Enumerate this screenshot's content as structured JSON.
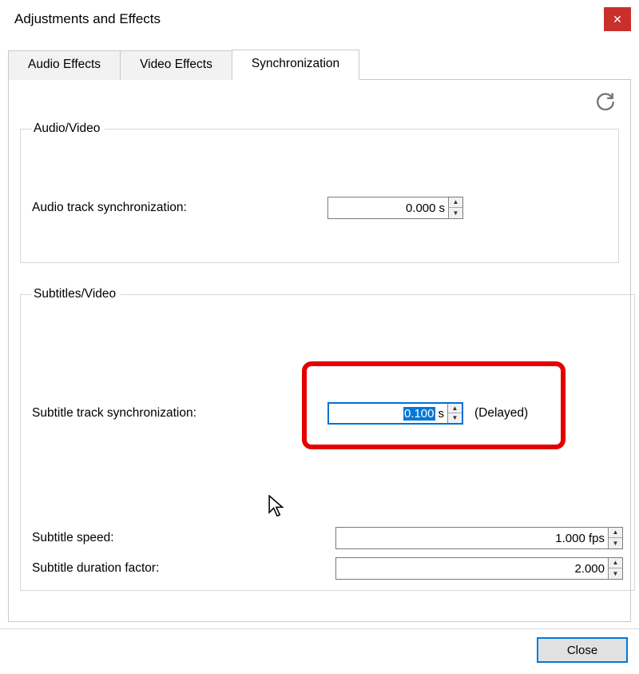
{
  "title": "Adjustments and Effects",
  "tabs": {
    "audio": "Audio Effects",
    "video": "Video Effects",
    "sync": "Synchronization"
  },
  "groups": {
    "av_legend": "Audio/Video",
    "sub_legend": "Subtitles/Video"
  },
  "fields": {
    "audio_track": {
      "label": "Audio track synchronization:",
      "value": "0.000",
      "unit": " s"
    },
    "sub_track": {
      "label": "Subtitle track synchronization:",
      "value": "0.100",
      "unit": " s",
      "status": "(Delayed)"
    },
    "sub_speed": {
      "label": "Subtitle speed:",
      "value": "1.000 fps"
    },
    "sub_dur": {
      "label": "Subtitle duration factor:",
      "value": "2.000"
    }
  },
  "footer": {
    "close": "Close"
  }
}
